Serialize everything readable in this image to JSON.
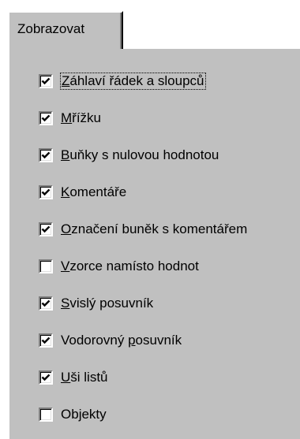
{
  "tab": {
    "label": "Zobrazovat"
  },
  "options": [
    {
      "pre": "",
      "key": "Z",
      "post": "áhlaví řádek a sloupců",
      "checked": true,
      "focused": true
    },
    {
      "pre": "",
      "key": "M",
      "post": "řížku",
      "checked": true,
      "focused": false
    },
    {
      "pre": "",
      "key": "B",
      "post": "uňky s nulovou hodnotou",
      "checked": true,
      "focused": false
    },
    {
      "pre": "",
      "key": "K",
      "post": "omentáře",
      "checked": true,
      "focused": false
    },
    {
      "pre": "",
      "key": "O",
      "post": "značení buněk s komentářem",
      "checked": true,
      "focused": false
    },
    {
      "pre": "",
      "key": "V",
      "post": "zorce namísto hodnot",
      "checked": false,
      "focused": false
    },
    {
      "pre": "",
      "key": "S",
      "post": "vislý posuvník",
      "checked": true,
      "focused": false
    },
    {
      "pre": "Vodorovný ",
      "key": "p",
      "post": "osuvník",
      "checked": true,
      "focused": false
    },
    {
      "pre": "",
      "key": "U",
      "post": "ši listů",
      "checked": true,
      "focused": false
    },
    {
      "pre": "Ob",
      "key": "j",
      "post": "ekty",
      "checked": false,
      "focused": false
    }
  ],
  "colors": {
    "face": "#c0c0c0",
    "highlight": "#ffffff",
    "shadow": "#808080",
    "dark": "#000000"
  }
}
